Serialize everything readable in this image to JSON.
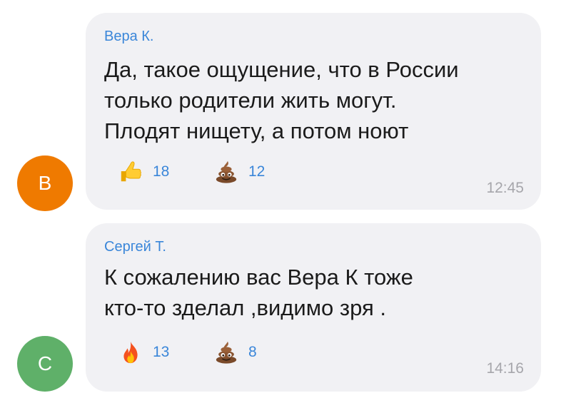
{
  "colors": {
    "bubble_bg": "#f1f1f4",
    "author": "#3a86d9",
    "reaction_count": "#3a86d9",
    "time": "#a6a6ab",
    "avatar_orange": "#ef7a00",
    "avatar_green": "#5fb069"
  },
  "messages": [
    {
      "avatar_letter": "В",
      "avatar_color": "#ef7a00",
      "author": "Вера К.",
      "lines": [
        "Да, такое ощущение, что в России",
        "только родители жить могут.",
        "Плодят нищету, а потом ноют"
      ],
      "reactions": [
        {
          "icon": "thumbs-up-icon",
          "count": "18"
        },
        {
          "icon": "poop-icon",
          "count": "12"
        }
      ],
      "time": "12:45"
    },
    {
      "avatar_letter": "С",
      "avatar_color": "#5fb069",
      "author": "Сергей Т.",
      "lines": [
        "К сожалению вас Вера К тоже",
        "кто-то зделал ,видимо зря ."
      ],
      "reactions": [
        {
          "icon": "fire-icon",
          "count": "13"
        },
        {
          "icon": "poop-icon",
          "count": "8"
        }
      ],
      "time": "14:16"
    }
  ]
}
